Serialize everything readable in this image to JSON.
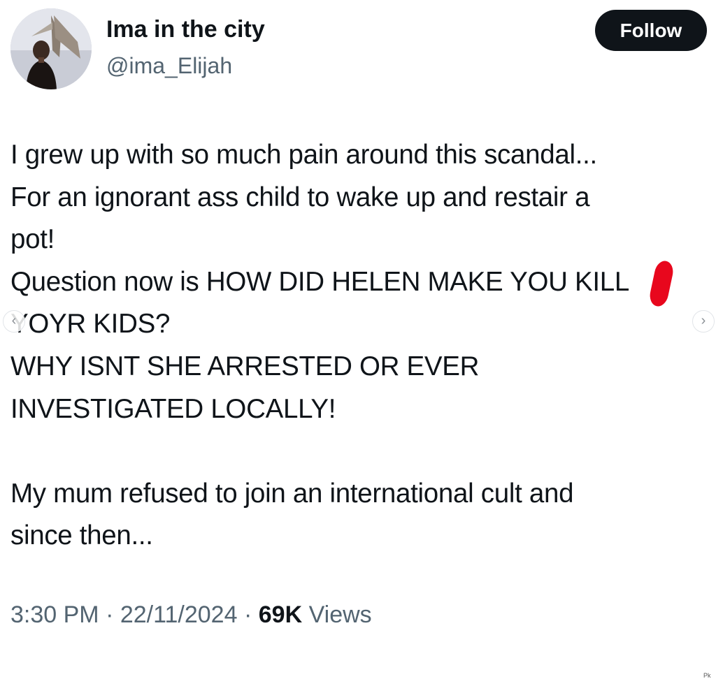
{
  "author": {
    "display_name": "Ima in the city",
    "handle": "@ima_Elijah"
  },
  "follow_button": {
    "label": "Follow"
  },
  "tweet": {
    "lines": [
      "I grew up with so much pain around this scandal...",
      "For an ignorant ass child to wake up and restair a",
      "pot!",
      "Question now is HOW DID HELEN MAKE YOU KILL",
      "YOYR KIDS?",
      "WHY ISNT SHE ARRESTED OR EVER",
      "INVESTIGATED LOCALLY!",
      "",
      "My mum refused to join an international cult and",
      "since then..."
    ]
  },
  "meta": {
    "time": "3:30 PM",
    "separator": "·",
    "date": "22/11/2024",
    "views_count": "69K",
    "views_label": "Views"
  },
  "carousel": {
    "prev_icon": "‹",
    "next_icon": "›"
  },
  "corner_tag": "Pk"
}
